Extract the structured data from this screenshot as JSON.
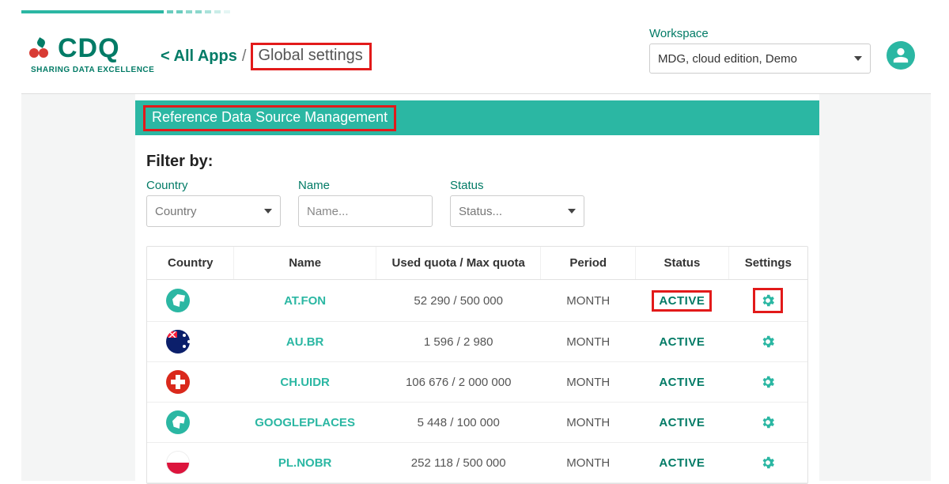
{
  "logo": {
    "text": "CDQ",
    "subtitle": "SHARING DATA EXCELLENCE"
  },
  "breadcrumb": {
    "all_apps": "< All Apps",
    "current": "Global settings"
  },
  "workspace": {
    "label": "Workspace",
    "selected": "MDG, cloud edition, Demo"
  },
  "page_title": "Reference Data Source Management",
  "filter": {
    "title": "Filter by:",
    "country_label": "Country",
    "country_placeholder": "Country",
    "name_label": "Name",
    "name_placeholder": "Name...",
    "status_label": "Status",
    "status_placeholder": "Status..."
  },
  "table": {
    "headers": {
      "country": "Country",
      "name": "Name",
      "quota": "Used quota / Max quota",
      "period": "Period",
      "status": "Status",
      "settings": "Settings"
    },
    "rows": [
      {
        "flag": "globe",
        "name": "AT.FON",
        "quota": "52 290 / 500 000",
        "period": "MONTH",
        "status": "ACTIVE",
        "highlight": true
      },
      {
        "flag": "au",
        "name": "AU.BR",
        "quota": "1 596 / 2 980",
        "period": "MONTH",
        "status": "ACTIVE",
        "highlight": false
      },
      {
        "flag": "ch",
        "name": "CH.UIDR",
        "quota": "106 676 / 2 000 000",
        "period": "MONTH",
        "status": "ACTIVE",
        "highlight": false
      },
      {
        "flag": "globe",
        "name": "GOOGLEPLACES",
        "quota": "5 448 / 100 000",
        "period": "MONTH",
        "status": "ACTIVE",
        "highlight": false
      },
      {
        "flag": "pl",
        "name": "PL.NOBR",
        "quota": "252 118 / 500 000",
        "period": "MONTH",
        "status": "ACTIVE",
        "highlight": false
      }
    ]
  }
}
